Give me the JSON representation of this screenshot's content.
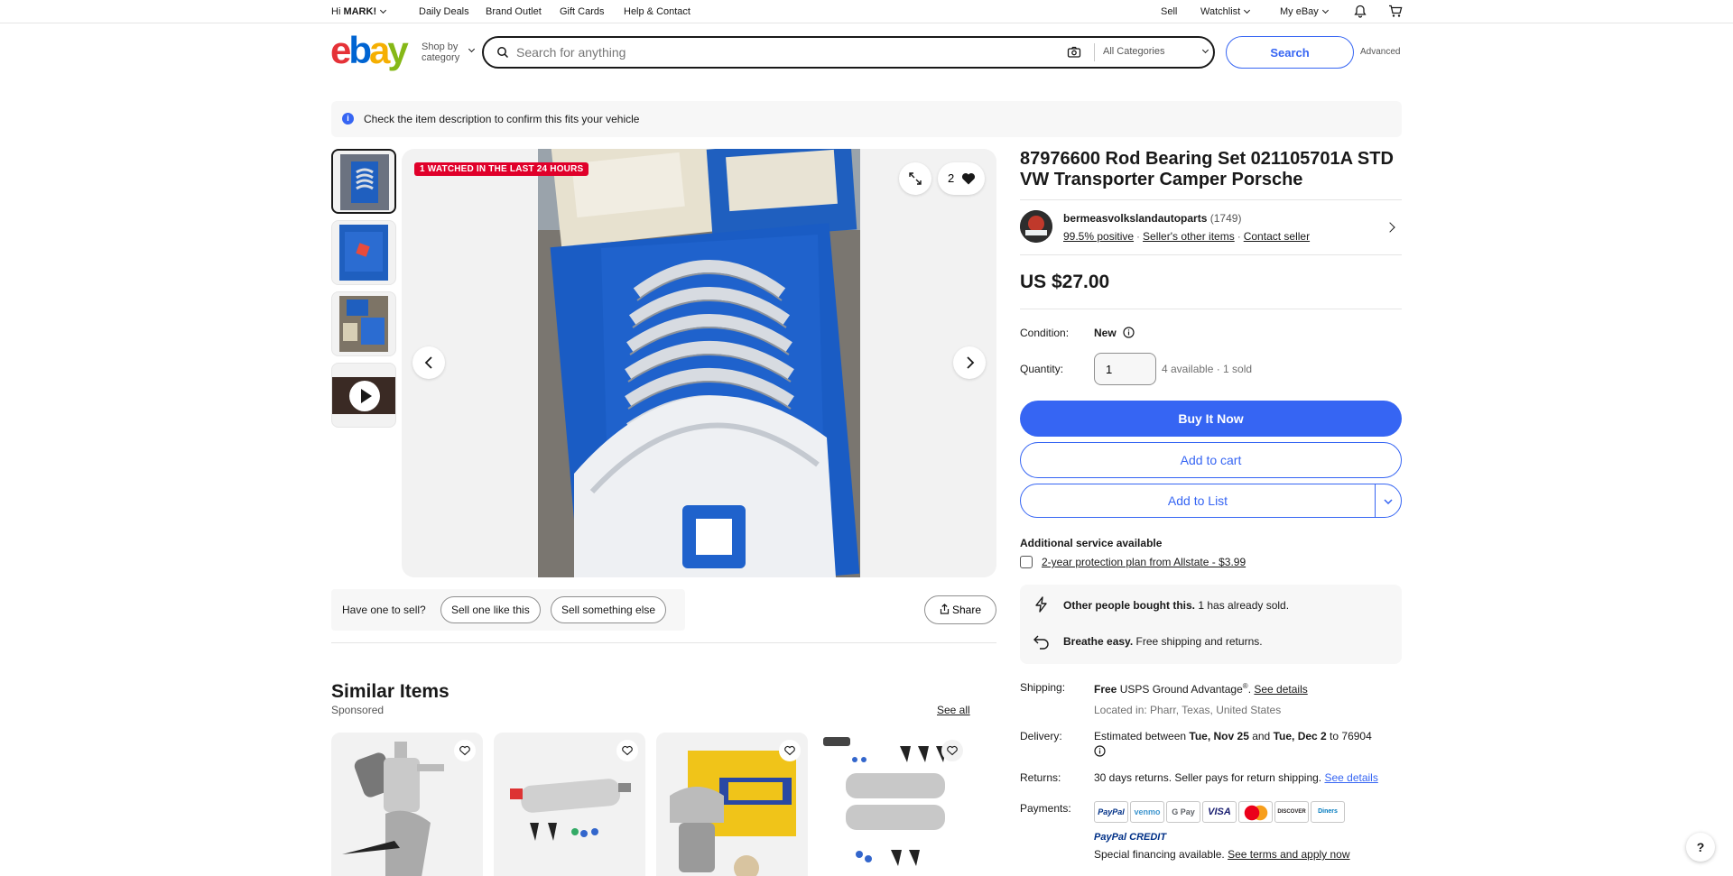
{
  "topbar": {
    "greeting_prefix": "Hi ",
    "greeting_name": "MARK!",
    "links": [
      "Daily Deals",
      "Brand Outlet",
      "Gift Cards",
      "Help & Contact"
    ],
    "sell": "Sell",
    "watchlist": "Watchlist",
    "myebay": "My eBay"
  },
  "header": {
    "logo": [
      "e",
      "b",
      "a",
      "y"
    ],
    "shop_by_line1": "Shop by",
    "shop_by_line2": "category",
    "search_placeholder": "Search for anything",
    "category": "All Categories",
    "search_button": "Search",
    "advanced": "Advanced"
  },
  "banner": {
    "text": "Check the item description to confirm this fits your vehicle"
  },
  "gallery": {
    "watched_badge": "1 WATCHED IN THE LAST 24 HOURS",
    "watch_count": "2"
  },
  "item": {
    "title": "87976600 Rod Bearing Set 021105701A STD VW Transporter Camper Porsche",
    "seller_name": "bermeasvolkslandautoparts",
    "seller_count": "(1749)",
    "seller_positive": "99.5% positive",
    "seller_other": "Seller's other items",
    "contact": "Contact seller",
    "price": "US $27.00",
    "condition_label": "Condition:",
    "condition_value": "New",
    "quantity_label": "Quantity:",
    "quantity_value": "1",
    "quantity_note": "4 available · 1 sold",
    "buy_now": "Buy It Now",
    "add_to_cart": "Add to cart",
    "add_to_list": "Add to List",
    "additional_service": "Additional service available",
    "protection_plan": "2-year protection plan from Allstate - $3.99"
  },
  "highlights": {
    "row1_bold": "Other people bought this.",
    "row1_text": " 1 has already sold.",
    "row2_bold": "Breathe easy.",
    "row2_text": " Free shipping and returns."
  },
  "shipping": {
    "shipping_label": "Shipping:",
    "shipping_free": "Free",
    "shipping_method": " USPS Ground Advantage",
    "shipping_reg": "®",
    "shipping_dot": ". ",
    "see_details": "See details",
    "located": "Located in: Pharr, Texas, United States",
    "delivery_label": "Delivery:",
    "delivery_prefix": "Estimated between ",
    "delivery_start": "Tue, Nov 25",
    "delivery_and": " and ",
    "delivery_end": "Tue, Dec 2",
    "delivery_to": " to 76904",
    "returns_label": "Returns:",
    "returns_text": "30 days returns. Seller pays for return shipping. ",
    "returns_link": "See details",
    "payments_label": "Payments:",
    "payment_methods": [
      "PayPal",
      "venmo",
      "G Pay",
      "VISA",
      "MC",
      "DISCOVER",
      "Diners"
    ],
    "paypal_credit": "PayPal CREDIT",
    "financing": "Special financing available. ",
    "financing_link": "See terms and apply now"
  },
  "sell": {
    "question": "Have one to sell?",
    "sell_like": "Sell one like this",
    "sell_else": "Sell something else",
    "share": "Share"
  },
  "similar": {
    "title": "Similar Items",
    "sponsored": "Sponsored",
    "see_all": "See all"
  },
  "help": "?",
  "colors": {
    "accent": "#3665f3",
    "badge": "#e0002a",
    "logo_red": "#e53238",
    "logo_blue": "#0064d2",
    "logo_yellow": "#f5af02",
    "logo_green": "#86b817"
  }
}
